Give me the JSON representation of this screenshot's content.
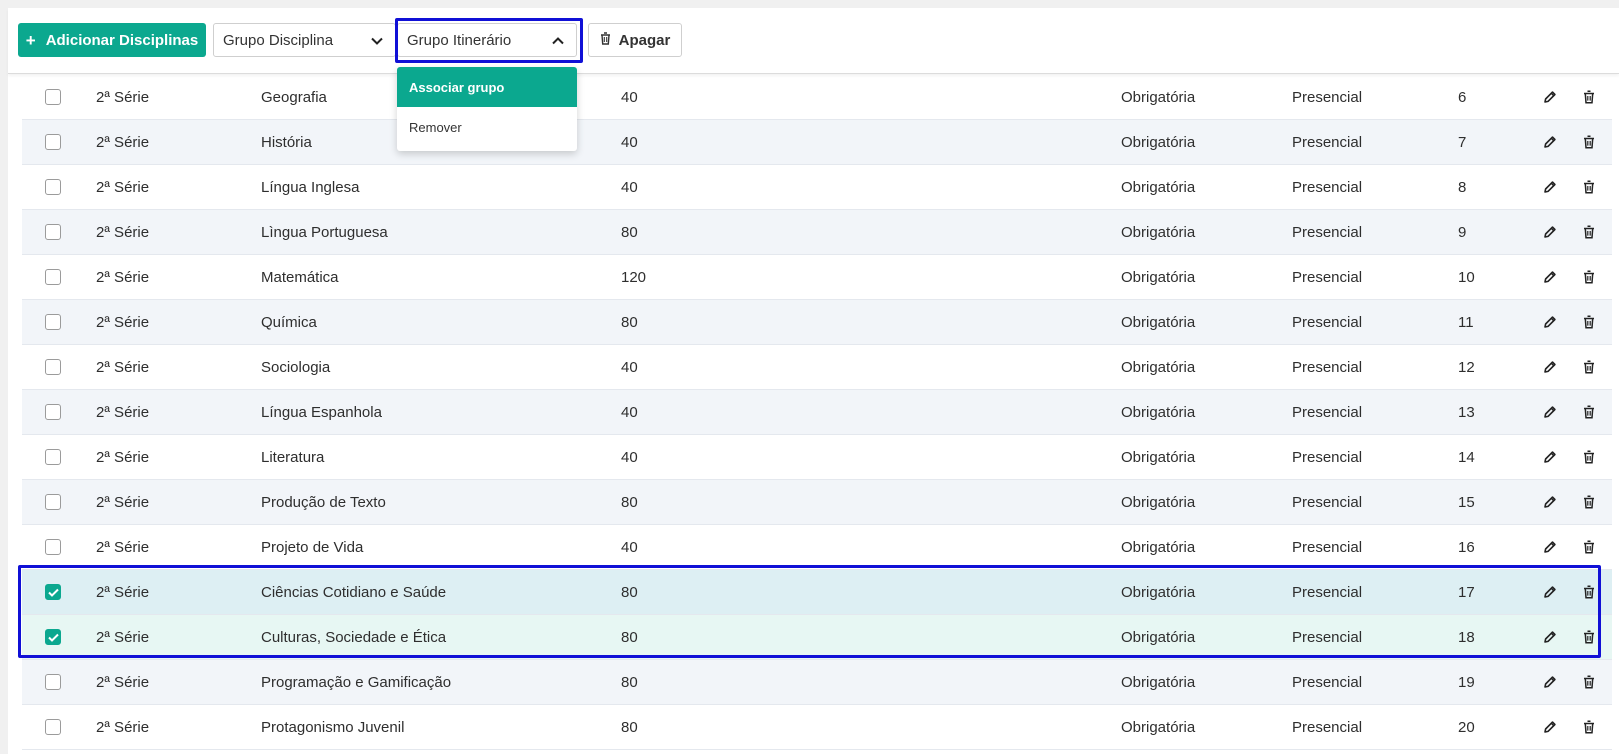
{
  "toolbar": {
    "add_label": "Adicionar Disciplinas",
    "grupo_disciplina_label": "Grupo Disciplina",
    "grupo_itinerario_label": "Grupo Itinerário",
    "apagar_label": "Apagar"
  },
  "dropdown": {
    "items": [
      {
        "label": "Associar grupo",
        "active": true
      },
      {
        "label": "Remover",
        "active": false
      }
    ]
  },
  "colors": {
    "accent": "#0ba88f",
    "highlight_frame": "#1010d6",
    "row_alt": "#f2f5f9",
    "row_selected_1": "#ddeff3",
    "row_selected_2": "#e7f7f3"
  },
  "table": {
    "rows": [
      {
        "serie": "2ª Série",
        "disciplina": "Geografia",
        "carga": "40",
        "tipo": "Obrigatória",
        "modalidade": "Presencial",
        "ordem": "6",
        "checked": false
      },
      {
        "serie": "2ª Série",
        "disciplina": "História",
        "carga": "40",
        "tipo": "Obrigatória",
        "modalidade": "Presencial",
        "ordem": "7",
        "checked": false
      },
      {
        "serie": "2ª Série",
        "disciplina": "Língua Inglesa",
        "carga": "40",
        "tipo": "Obrigatória",
        "modalidade": "Presencial",
        "ordem": "8",
        "checked": false
      },
      {
        "serie": "2ª Série",
        "disciplina": "Lìngua Portuguesa",
        "carga": "80",
        "tipo": "Obrigatória",
        "modalidade": "Presencial",
        "ordem": "9",
        "checked": false
      },
      {
        "serie": "2ª Série",
        "disciplina": "Matemática",
        "carga": "120",
        "tipo": "Obrigatória",
        "modalidade": "Presencial",
        "ordem": "10",
        "checked": false
      },
      {
        "serie": "2ª Série",
        "disciplina": "Química",
        "carga": "80",
        "tipo": "Obrigatória",
        "modalidade": "Presencial",
        "ordem": "11",
        "checked": false
      },
      {
        "serie": "2ª Série",
        "disciplina": "Sociologia",
        "carga": "40",
        "tipo": "Obrigatória",
        "modalidade": "Presencial",
        "ordem": "12",
        "checked": false
      },
      {
        "serie": "2ª Série",
        "disciplina": "Língua Espanhola",
        "carga": "40",
        "tipo": "Obrigatória",
        "modalidade": "Presencial",
        "ordem": "13",
        "checked": false
      },
      {
        "serie": "2ª Série",
        "disciplina": "Literatura",
        "carga": "40",
        "tipo": "Obrigatória",
        "modalidade": "Presencial",
        "ordem": "14",
        "checked": false
      },
      {
        "serie": "2ª Série",
        "disciplina": "Produção de Texto",
        "carga": "80",
        "tipo": "Obrigatória",
        "modalidade": "Presencial",
        "ordem": "15",
        "checked": false
      },
      {
        "serie": "2ª Série",
        "disciplina": "Projeto de Vida",
        "carga": "40",
        "tipo": "Obrigatória",
        "modalidade": "Presencial",
        "ordem": "16",
        "checked": false
      },
      {
        "serie": "2ª Série",
        "disciplina": "Ciências Cotidiano e Saúde",
        "carga": "80",
        "tipo": "Obrigatória",
        "modalidade": "Presencial",
        "ordem": "17",
        "checked": true
      },
      {
        "serie": "2ª Série",
        "disciplina": "Culturas, Sociedade e Ética",
        "carga": "80",
        "tipo": "Obrigatória",
        "modalidade": "Presencial",
        "ordem": "18",
        "checked": true
      },
      {
        "serie": "2ª Série",
        "disciplina": "Programação e Gamificação",
        "carga": "80",
        "tipo": "Obrigatória",
        "modalidade": "Presencial",
        "ordem": "19",
        "checked": false
      },
      {
        "serie": "2ª Série",
        "disciplina": "Protagonismo Juvenil",
        "carga": "80",
        "tipo": "Obrigatória",
        "modalidade": "Presencial",
        "ordem": "20",
        "checked": false
      }
    ]
  }
}
